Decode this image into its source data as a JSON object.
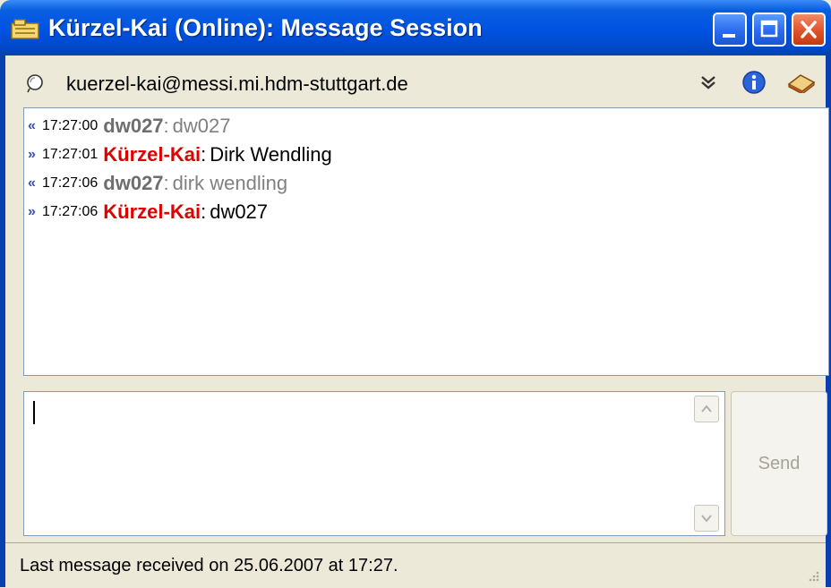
{
  "window": {
    "title": "Kürzel-Kai (Online): Message Session",
    "controls": [
      "minimize",
      "maximize",
      "close"
    ]
  },
  "contact": {
    "address": "kuerzel-kai@messi.mi.hdm-stuttgart.de",
    "icons": [
      "status-bulb-icon",
      "dropdown-chevron-icon",
      "info-icon",
      "history-book-icon"
    ]
  },
  "messages": [
    {
      "direction": "in",
      "time": "17:27:00",
      "sender": "dw027",
      "separator": ":",
      "text": "dw027"
    },
    {
      "direction": "out",
      "time": "17:27:01",
      "sender": "Kürzel-Kai",
      "separator": ":",
      "text": "Dirk Wendling"
    },
    {
      "direction": "in",
      "time": "17:27:06",
      "sender": "dw027",
      "separator": ":",
      "text": "dirk wendling"
    },
    {
      "direction": "out",
      "time": "17:27:06",
      "sender": "Kürzel-Kai",
      "separator": ":",
      "text": "dw027"
    }
  ],
  "input": {
    "value": ""
  },
  "send_button": {
    "label": "Send",
    "enabled": false
  },
  "statusbar": {
    "text": "Last message received on 25.06.2007 at 17:27."
  },
  "colors": {
    "titlebar": "#0054e3",
    "incoming_sender": "#6e6e6e",
    "outgoing_sender": "#e00000",
    "close_button": "#e0532a"
  }
}
